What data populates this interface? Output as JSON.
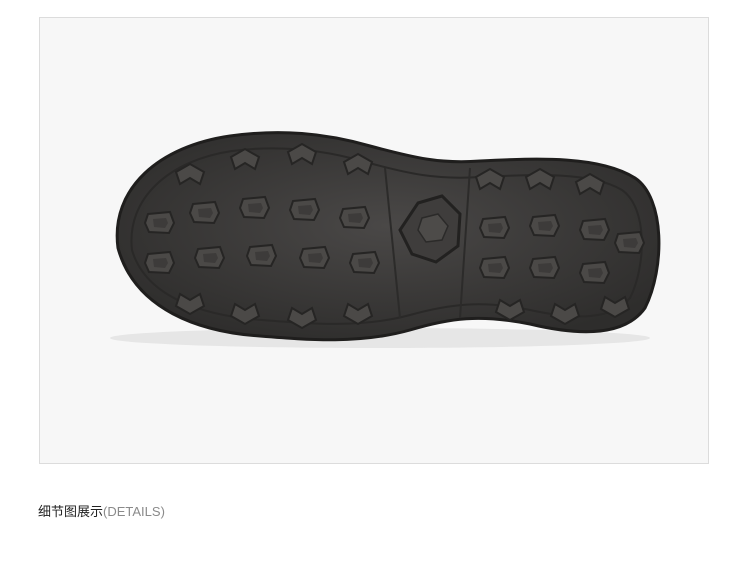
{
  "caption": {
    "main": "细节图展示",
    "sub": "(DETAILS)"
  },
  "photo": {
    "subject": "shoe-sole-icon",
    "background_color": "#f7f7f7",
    "sole_color": "#3b3a39",
    "lug_color": "#4a4846"
  }
}
